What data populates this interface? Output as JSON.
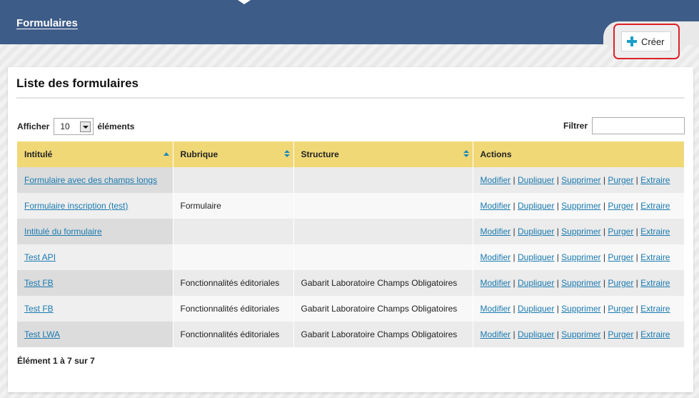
{
  "header": {
    "title": "Formulaires",
    "create_label": "Créer",
    "create_icon": "plus-icon",
    "bar_color": "#3e5c88",
    "highlight_color": "#e0202a"
  },
  "panel": {
    "title": "Liste des formulaires"
  },
  "length": {
    "prefix": "Afficher",
    "value": "10",
    "suffix": "éléments"
  },
  "filter": {
    "label": "Filtrer",
    "value": "",
    "placeholder": ""
  },
  "table": {
    "header_color": "#f0d877",
    "columns": [
      "Intitulé",
      "Rubrique",
      "Structure",
      "Actions"
    ],
    "action_labels": [
      "Modifier",
      "Dupliquer",
      "Supprimer",
      "Purger",
      "Extraire"
    ],
    "rows": [
      {
        "intitule": "Formulaire avec des champs longs",
        "rubrique": "",
        "structure": ""
      },
      {
        "intitule": "Formulaire inscription (test)",
        "rubrique": "Formulaire",
        "structure": ""
      },
      {
        "intitule": "Intitulé du formulaire",
        "rubrique": "",
        "structure": ""
      },
      {
        "intitule": "Test API",
        "rubrique": "",
        "structure": ""
      },
      {
        "intitule": "Test FB",
        "rubrique": "Fonctionnalités éditoriales",
        "structure": "Gabarit Laboratoire Champs Obligatoires"
      },
      {
        "intitule": "Test FB",
        "rubrique": "Fonctionnalités éditoriales",
        "structure": "Gabarit Laboratoire Champs Obligatoires"
      },
      {
        "intitule": "Test LWA",
        "rubrique": "Fonctionnalités éditoriales",
        "structure": "Gabarit Laboratoire Champs Obligatoires"
      }
    ]
  },
  "info": {
    "prefix": "Élément",
    "start": "1",
    "middle": "à",
    "end": "7",
    "word_total": "sur",
    "total": "7"
  }
}
